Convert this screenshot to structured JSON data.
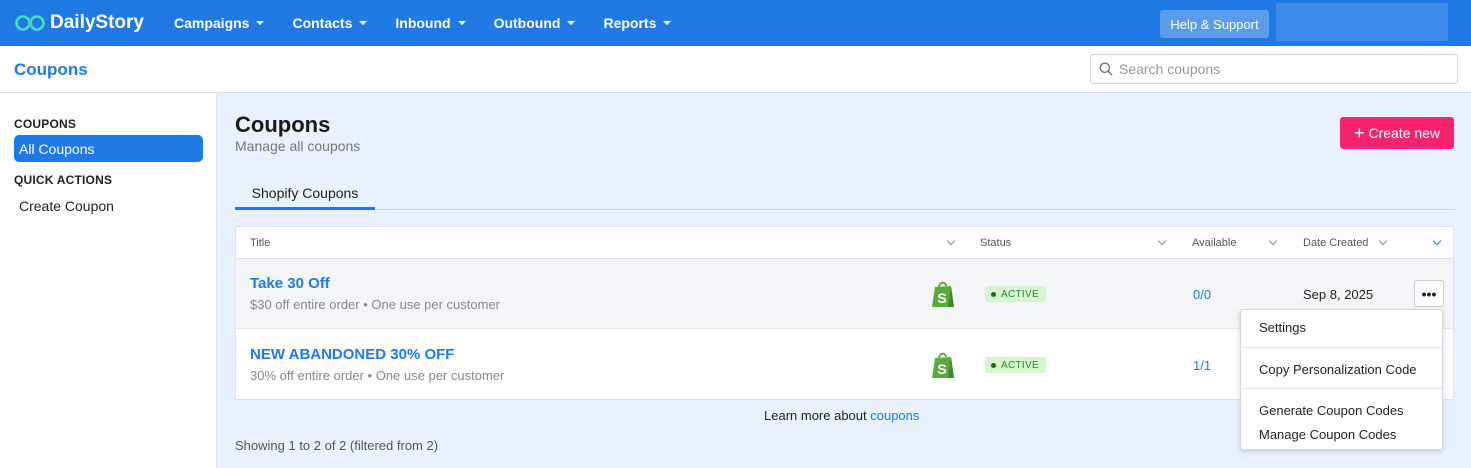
{
  "brand": {
    "name": "DailyStory"
  },
  "nav": {
    "items": [
      {
        "label": "Campaigns"
      },
      {
        "label": "Contacts"
      },
      {
        "label": "Inbound"
      },
      {
        "label": "Outbound"
      },
      {
        "label": "Reports"
      }
    ],
    "help_label": "Help & Support"
  },
  "subheader": {
    "title": "Coupons",
    "search_placeholder": "Search coupons"
  },
  "sidebar": {
    "section1": "COUPONS",
    "active_item": "All Coupons",
    "section2": "QUICK ACTIONS",
    "link": "Create Coupon"
  },
  "main": {
    "title": "Coupons",
    "subtitle": "Manage all coupons",
    "create_label": "Create new",
    "tab": "Shopify Coupons"
  },
  "table": {
    "columns": {
      "title": "Title",
      "status": "Status",
      "available": "Available",
      "date": "Date Created"
    },
    "rows": [
      {
        "title": "Take 30 Off",
        "desc": "$30 off entire order • One use per customer",
        "status": "ACTIVE",
        "available": "0/0",
        "date": "Sep 8, 2025",
        "more": "•••"
      },
      {
        "title": "NEW ABANDONED 30% OFF",
        "desc": "30% off entire order • One use per customer",
        "status": "ACTIVE",
        "available": "1/1"
      }
    ]
  },
  "footer": {
    "learn_prefix": "Learn more about ",
    "learn_link": "coupons",
    "showing": "Showing 1 to 2 of 2 (filtered from 2)"
  },
  "menu": {
    "settings": "Settings",
    "copy": "Copy Personalization Code",
    "generate": "Generate Coupon Codes",
    "manage": "Manage Coupon Codes"
  },
  "colors": {
    "primary": "#1f7ae6",
    "accent": "#f5246e",
    "active_badge_bg": "#d8f5d2",
    "shopify_green": "#5aaa3e"
  },
  "icons": [
    "dailystory-logo-icon",
    "search-icon",
    "plus-icon",
    "shopify-icon",
    "chevron-down-icon",
    "more-icon"
  ]
}
